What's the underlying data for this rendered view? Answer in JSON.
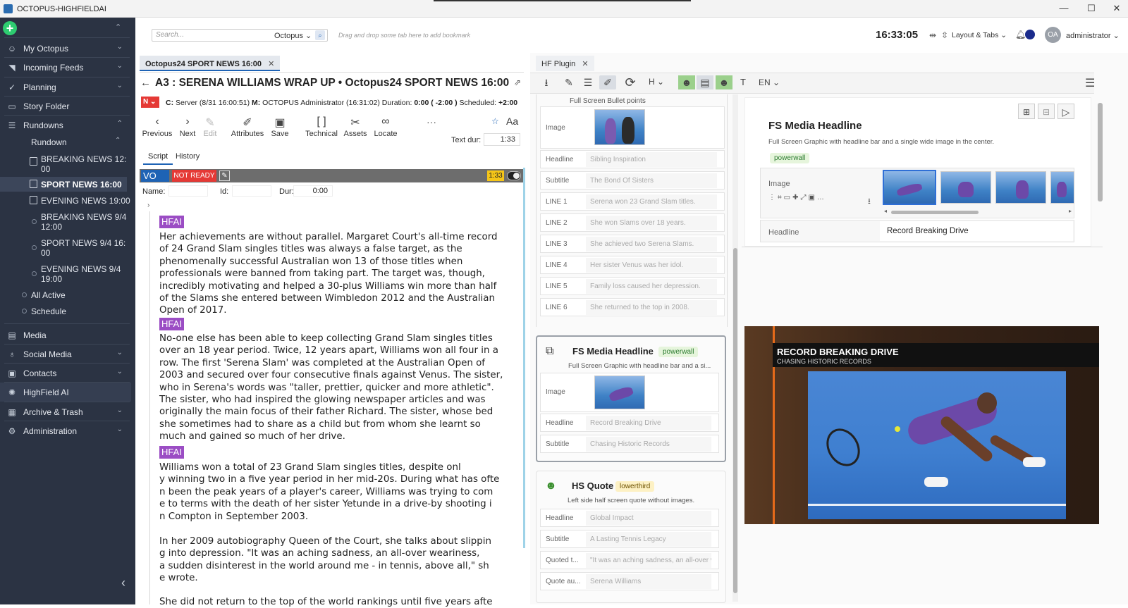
{
  "app": {
    "title": "OCTOPUS-HIGHFIELDAI"
  },
  "window": {
    "minimize": "—",
    "maximize": "☐",
    "close": "✕"
  },
  "sidebar": {
    "items": [
      {
        "label": "My Octopus"
      },
      {
        "label": "Incoming Feeds"
      },
      {
        "label": "Planning"
      },
      {
        "label": "Story Folder"
      },
      {
        "label": "Rundowns"
      }
    ],
    "rundown_label": "Rundown",
    "rundowns": [
      {
        "label": "BREAKING NEWS 12:\n00"
      },
      {
        "label": "SPORT NEWS 16:00"
      },
      {
        "label": "EVENING NEWS 19:00"
      },
      {
        "label": "BREAKING NEWS 9/4\n12:00"
      },
      {
        "label": "SPORT NEWS 9/4 16:\n00"
      },
      {
        "label": "EVENING NEWS 9/4\n19:00"
      }
    ],
    "all_active": "All Active",
    "schedule": "Schedule",
    "bottom_items": [
      {
        "label": "Media"
      },
      {
        "label": "Social Media"
      },
      {
        "label": "Contacts"
      },
      {
        "label": "HighField AI"
      },
      {
        "label": "Archive & Trash"
      },
      {
        "label": "Administration"
      }
    ],
    "collapse": "‹"
  },
  "topbar": {
    "search_placeholder": "Search...",
    "search_scope": "Octopus",
    "bookmark_hint": "Drag and drop some tab here to add bookmark",
    "clock": "16:33:05",
    "layout_tabs": "Layout & Tabs",
    "user_initials": "OA",
    "user_name": "administrator"
  },
  "doc_tab": {
    "label": "Octopus24 SPORT NEWS 16:00"
  },
  "story": {
    "title": "A3 : SERENA WILLIAMS WRAP UP • Octopus24 SPORT NEWS 16:00",
    "status_flag": "N",
    "meta": {
      "c_label": "C:",
      "c_value": "Server (8/31 16:00:51)",
      "m_label": "M:",
      "m_value": "OCTOPUS Administrator (16:31:02)",
      "duration_label": "Duration:",
      "duration_value": "0:00",
      "duration_diff": "( -2:00 )",
      "scheduled_label": "Scheduled:",
      "scheduled_value": "+2:00"
    },
    "toolbar": [
      {
        "label": "Previous"
      },
      {
        "label": "Next"
      },
      {
        "label": "Edit"
      },
      {
        "label": "Attributes"
      },
      {
        "label": "Save"
      },
      {
        "label": "Technical"
      },
      {
        "label": "Assets"
      },
      {
        "label": "Locate"
      }
    ],
    "more": "···",
    "font_btn": "Aa",
    "text_dur_label": "Text dur:",
    "text_dur_value": "1:33",
    "tabs": [
      "Script",
      "History"
    ],
    "element": {
      "type": "VO",
      "state": "NOT READY",
      "dur_badge": "1:33",
      "name_label": "Name:",
      "id_label": "Id:",
      "dur_label": "Dur:",
      "dur_value": "0:00"
    },
    "hfai_tag": "HFAI",
    "paragraphs": [
      "Her achievements are without parallel. Margaret Court's all-time record of 24 Grand Slam singles titles was always a false target, as the phenomenally successful Australian won 13 of those titles when professionals were banned from taking part. The target was, though, incredibly motivating and helped a 30-plus Williams win more than half of the Slams she entered between Wimbledon 2012 and the Australian Open of 2017.",
      "No-one else has been able to keep collecting Grand Slam singles titles over an 18 year period. Twice, 12 years apart, Williams won all four in a row. The first 'Serena Slam' was completed at the Australian Open of 2003 and secured over four consecutive finals against Venus. The sister, who in Serena's words was \"taller, prettier, quicker and more athletic\". The sister, who had inspired the glowing newspaper articles and was originally the main focus of their father Richard. The sister, whose bed she sometimes had to share as a child but from whom she learnt so much and gained so much of her drive.",
      "Williams won a total of 23 Grand Slam singles titles, despite onl\ny winning two in a five year period in her mid-20s. During what has ofte\nn been the peak years of a player's career, Williams was trying to com\ne to terms with the death of her sister Yetunde in a drive-by shooting i\nn Compton in September 2003.",
      "In her 2009 autobiography Queen of the Court, she talks about slippin\ng into depression. \"It was an aching sadness, an all-over weariness,\na sudden disinterest in the world around me - in tennis, above all,\" sh\ne wrote.",
      "She did not return to the top of the world rankings until five years afte"
    ]
  },
  "plugin": {
    "tab_label": "HF Plugin",
    "lang": "EN",
    "heading_btn": "H",
    "text_btn": "T",
    "bullet_card": {
      "description": "Full Screen Bullet points",
      "rows": [
        {
          "label": "Image",
          "value": ""
        },
        {
          "label": "Headline",
          "value": "Sibling Inspiration"
        },
        {
          "label": "Subtitle",
          "value": "The Bond Of Sisters"
        },
        {
          "label": "LINE 1",
          "value": "Serena won 23 Grand Slam titles."
        },
        {
          "label": "LINE 2",
          "value": "She won Slams over 18 years."
        },
        {
          "label": "LINE 3",
          "value": "She achieved two Serena Slams."
        },
        {
          "label": "LINE 4",
          "value": "Her sister Venus was her idol."
        },
        {
          "label": "LINE 5",
          "value": "Family loss caused her depression."
        },
        {
          "label": "LINE 6",
          "value": "She returned to the top in 2008."
        }
      ]
    },
    "media_card": {
      "title": "FS Media Headline",
      "badge": "powerwall",
      "description": "Full Screen Graphic with headline bar and a si...",
      "rows": [
        {
          "label": "Image",
          "value": ""
        },
        {
          "label": "Headline",
          "value": "Record Breaking Drive"
        },
        {
          "label": "Subtitle",
          "value": "Chasing Historic Records"
        }
      ]
    },
    "quote_card": {
      "title": "HS Quote",
      "badge": "lowerthird",
      "description": "Left side half screen quote without images.",
      "rows": [
        {
          "label": "Headline",
          "value": "Global Impact"
        },
        {
          "label": "Subtitle",
          "value": "A Lasting Tennis Legacy"
        },
        {
          "label": "Quoted t...",
          "value": "\"It was an aching sadness, an all-over v"
        },
        {
          "label": "Quote au...",
          "value": "Serena Williams"
        }
      ]
    },
    "detail": {
      "title": "FS Media Headline",
      "description": "Full Screen Graphic with headline bar and a single wide image in the center.",
      "badge": "powerwall",
      "image_label": "Image",
      "headline_label": "Headline",
      "headline_value": "Record Breaking Drive"
    },
    "preview": {
      "headline": "RECORD BREAKING DRIVE",
      "subtitle": "CHASING HISTORIC RECORDS"
    }
  },
  "colors": {
    "sidebar_bg": "#2b3343",
    "accent": "#1e63b5",
    "hfai": "#9b4dc4",
    "not_ready": "#e53935",
    "vo_bar": "#6d6d6d",
    "preview_bar": "#e66a1a"
  }
}
